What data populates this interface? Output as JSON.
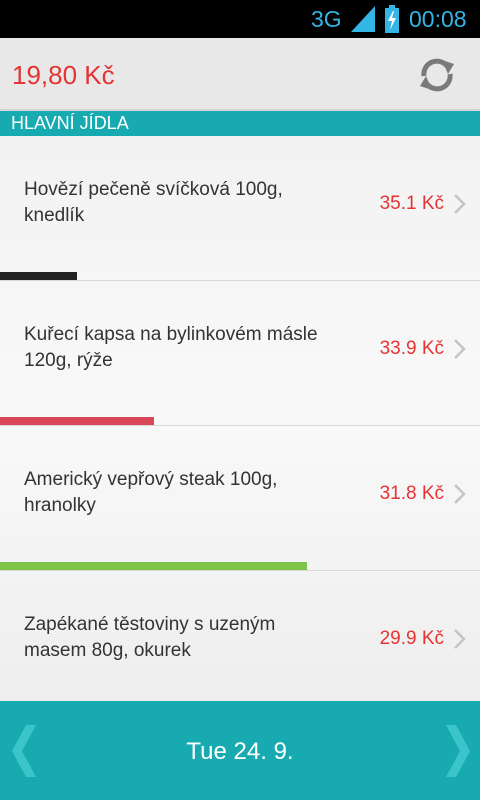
{
  "status_bar": {
    "network": "3G",
    "time": "00:08"
  },
  "header": {
    "balance": "19,80 Kč"
  },
  "section": {
    "title": "HLAVNÍ JÍDLA"
  },
  "menu": {
    "items": [
      {
        "name": "Hovězí pečeně svíčková 100g, knedlík",
        "price": "35.1 Kč",
        "bar_color": "#222222",
        "bar_fill": 0.16
      },
      {
        "name": "Kuřecí kapsa na bylinkovém másle 120g, rýže",
        "price": "33.9 Kč",
        "bar_color": "#d9475a",
        "bar_fill": 0.32
      },
      {
        "name": "Americký vepřový steak 100g, hranolky",
        "price": "31.8 Kč",
        "bar_color": "#7cc348",
        "bar_fill": 0.64
      },
      {
        "name": "Zapékané těstoviny s uzeným masem 80g, okurek",
        "price": "29.9 Kč",
        "bar_color": "",
        "bar_fill": 0
      }
    ]
  },
  "footer": {
    "date": "Tue  24. 9."
  },
  "colors": {
    "accent": "#17aab1",
    "price": "#e63333",
    "status": "#33b5e5"
  }
}
